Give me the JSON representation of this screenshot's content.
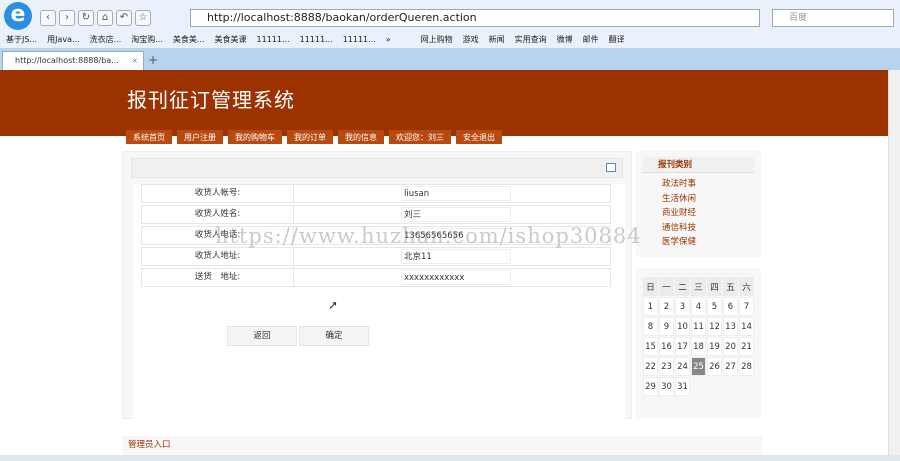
{
  "browser": {
    "url": "http://localhost:8888/baokan/orderQueren.action",
    "search_placeholder": "百度",
    "tab_title": "http://localhost:8888/ba...",
    "tab_close": "×",
    "new_tab": "+",
    "bookmarks": [
      "基于JS...",
      "用Java...",
      "洗衣店...",
      "淘宝购...",
      "美食美...",
      "美食美课",
      "11111...",
      "11111...",
      "11111...",
      "»",
      "网上购物",
      "游戏",
      "新闻",
      "实用查询",
      "微博",
      "邮件",
      "翻译"
    ]
  },
  "site": {
    "title": "报刊征订管理系统",
    "menu": [
      "系统首页",
      "用户注册",
      "我的购物车",
      "我的订单",
      "我的信息",
      "欢迎您：刘三",
      "安全退出"
    ]
  },
  "form": {
    "rows": [
      {
        "label": "收货人帐号:",
        "value": "liusan"
      },
      {
        "label": "收货人姓名:",
        "value": "刘三"
      },
      {
        "label": "收货人电话:",
        "value": "13656565656"
      },
      {
        "label": "收货人地址:",
        "value": "北京11"
      },
      {
        "label": "送货　地址:",
        "value": "xxxxxxxxxxxx"
      }
    ],
    "back": "返回",
    "confirm": "确定"
  },
  "sidebar": {
    "heading": "报刊类别",
    "categories": [
      "政法时事",
      "生活休闲",
      "商业财经",
      "通信科技",
      "医学保健"
    ]
  },
  "calendar": {
    "weekdays": [
      "日",
      "一",
      "二",
      "三",
      "四",
      "五",
      "六"
    ],
    "today": "25",
    "weeks": [
      [
        "",
        "1",
        "2",
        "3",
        "4",
        "5",
        "6",
        "7"
      ],
      [
        "8",
        "9",
        "10",
        "11",
        "12",
        "13",
        "14"
      ],
      [
        "15",
        "16",
        "17",
        "18",
        "19",
        "20",
        "21"
      ],
      [
        "22",
        "23",
        "24",
        "25",
        "26",
        "27",
        "28"
      ],
      [
        "29",
        "30",
        "31",
        "",
        "",
        "",
        ""
      ]
    ]
  },
  "footer": {
    "admin_link": "管理员入口"
  },
  "watermark": "https://www.huzhan.com/ishop30884"
}
